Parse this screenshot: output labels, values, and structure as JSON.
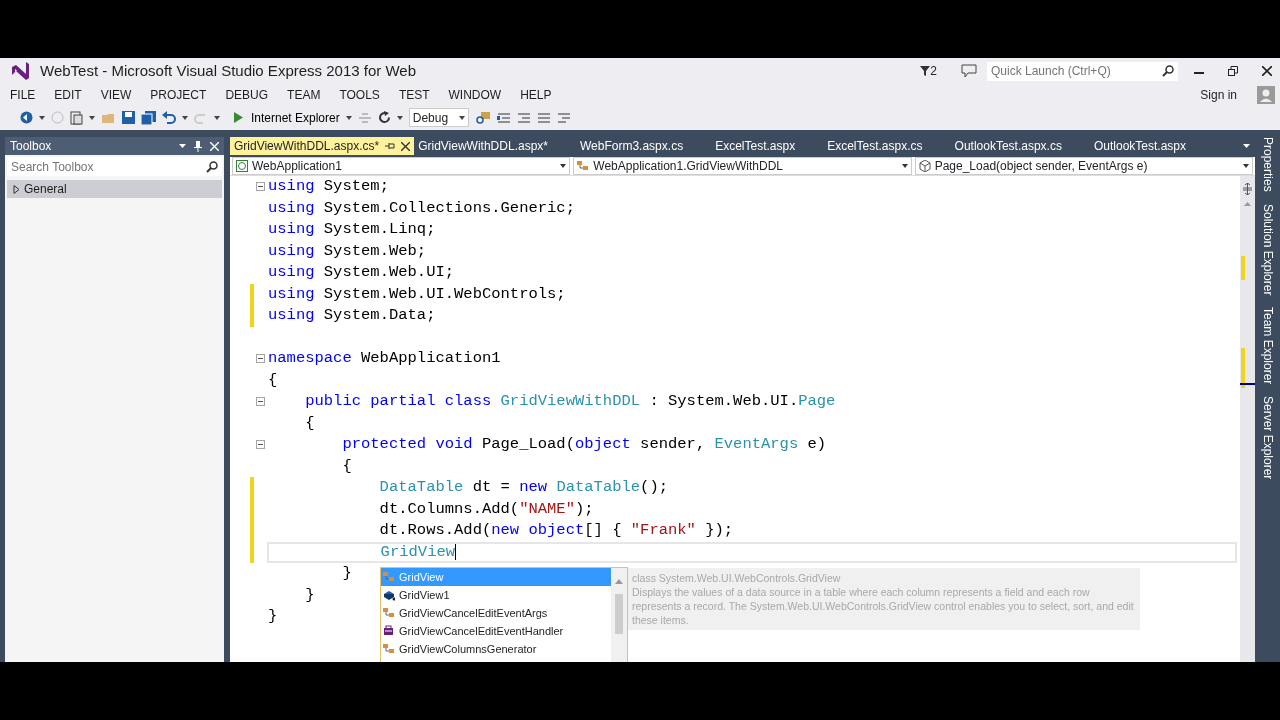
{
  "window": {
    "title": "WebTest - Microsoft Visual Studio Express 2013 for Web",
    "notifications": "2",
    "quick_launch": {
      "placeholder": "Quick Launch (Ctrl+Q)"
    },
    "sign_in": "Sign in"
  },
  "menu": [
    "FILE",
    "EDIT",
    "VIEW",
    "PROJECT",
    "DEBUG",
    "TEAM",
    "TOOLS",
    "TEST",
    "WINDOW",
    "HELP"
  ],
  "toolbar": {
    "run_target": "Internet Explorer",
    "configuration": "Debug"
  },
  "toolbox": {
    "title": "Toolbox",
    "search": {
      "placeholder": "Search Toolbox"
    },
    "groups": [
      {
        "label": "General",
        "expanded": false
      }
    ]
  },
  "tabs": [
    {
      "label": "GridViewWithDDL.aspx.cs*",
      "selected": true
    },
    {
      "label": "GridViewWithDDL.aspx*",
      "selected": false
    },
    {
      "label": "WebForm3.aspx.cs",
      "selected": false
    },
    {
      "label": "ExcelTest.aspx",
      "selected": false
    },
    {
      "label": "ExcelTest.aspx.cs",
      "selected": false
    },
    {
      "label": "OutlookTest.aspx.cs",
      "selected": false
    },
    {
      "label": "OutlookTest.aspx",
      "selected": false
    }
  ],
  "nav_bar": {
    "project": "WebApplication1",
    "type": "WebApplication1.GridViewWithDDL",
    "member": "Page_Load(object sender, EventArgs e)"
  },
  "code": [
    {
      "collapsible": true,
      "changed": false,
      "current": false,
      "tokens": [
        {
          "kind": "keyword",
          "text": "using"
        },
        {
          "kind": "plain",
          "text": " System;"
        }
      ]
    },
    {
      "collapsible": false,
      "changed": false,
      "current": false,
      "tokens": [
        {
          "kind": "keyword",
          "text": "using"
        },
        {
          "kind": "plain",
          "text": " System.Collections.Generic;"
        }
      ]
    },
    {
      "collapsible": false,
      "changed": false,
      "current": false,
      "tokens": [
        {
          "kind": "keyword",
          "text": "using"
        },
        {
          "kind": "plain",
          "text": " System.Linq;"
        }
      ]
    },
    {
      "collapsible": false,
      "changed": false,
      "current": false,
      "tokens": [
        {
          "kind": "keyword",
          "text": "using"
        },
        {
          "kind": "plain",
          "text": " System.Web;"
        }
      ]
    },
    {
      "collapsible": false,
      "changed": false,
      "current": false,
      "tokens": [
        {
          "kind": "keyword",
          "text": "using"
        },
        {
          "kind": "plain",
          "text": " System.Web.UI;"
        }
      ]
    },
    {
      "collapsible": false,
      "changed": true,
      "current": false,
      "tokens": [
        {
          "kind": "keyword",
          "text": "using"
        },
        {
          "kind": "plain",
          "text": " System.Web.UI.WebControls;"
        }
      ]
    },
    {
      "collapsible": false,
      "changed": true,
      "current": false,
      "tokens": [
        {
          "kind": "keyword",
          "text": "using"
        },
        {
          "kind": "plain",
          "text": " System.Data;"
        }
      ]
    },
    {
      "collapsible": false,
      "changed": false,
      "current": false
    },
    {
      "collapsible": true,
      "changed": false,
      "current": false,
      "tokens": [
        {
          "kind": "keyword",
          "text": "namespace"
        },
        {
          "kind": "plain",
          "text": " WebApplication1"
        }
      ]
    },
    {
      "collapsible": false,
      "changed": false,
      "current": false,
      "tokens": [
        {
          "kind": "plain",
          "text": "{"
        }
      ]
    },
    {
      "collapsible": true,
      "changed": false,
      "current": false,
      "tokens": [
        {
          "kind": "keyword",
          "text": "    public partial class "
        },
        {
          "kind": "type",
          "text": "GridViewWithDDL"
        },
        {
          "kind": "plain",
          "text": " : System.Web.UI."
        },
        {
          "kind": "type",
          "text": "Page"
        }
      ]
    },
    {
      "collapsible": false,
      "changed": false,
      "current": false,
      "tokens": [
        {
          "kind": "plain",
          "text": "    {"
        }
      ]
    },
    {
      "collapsible": true,
      "changed": false,
      "current": false,
      "tokens": [
        {
          "kind": "keyword",
          "text": "        protected void"
        },
        {
          "kind": "plain",
          "text": " Page_Load("
        },
        {
          "kind": "keyword",
          "text": "object"
        },
        {
          "kind": "plain",
          "text": " sender, "
        },
        {
          "kind": "type",
          "text": "EventArgs"
        },
        {
          "kind": "plain",
          "text": " e)"
        }
      ]
    },
    {
      "collapsible": false,
      "changed": false,
      "current": false,
      "tokens": [
        {
          "kind": "plain",
          "text": "        {"
        }
      ]
    },
    {
      "collapsible": false,
      "changed": true,
      "current": false,
      "tokens": [
        {
          "kind": "type",
          "text": "            DataTable"
        },
        {
          "kind": "plain",
          "text": " dt = "
        },
        {
          "kind": "keyword",
          "text": "new "
        },
        {
          "kind": "type",
          "text": "DataTable"
        },
        {
          "kind": "plain",
          "text": "();"
        }
      ]
    },
    {
      "collapsible": false,
      "changed": true,
      "current": false,
      "tokens": [
        {
          "kind": "plain",
          "text": "            dt.Columns.Add("
        },
        {
          "kind": "string",
          "text": "\"NAME\""
        },
        {
          "kind": "plain",
          "text": ");"
        }
      ]
    },
    {
      "collapsible": false,
      "changed": true,
      "current": false,
      "tokens": [
        {
          "kind": "plain",
          "text": "            dt.Rows.Add("
        },
        {
          "kind": "keyword",
          "text": "new object"
        },
        {
          "kind": "plain",
          "text": "[] { "
        },
        {
          "kind": "string",
          "text": "\"Frank\""
        },
        {
          "kind": "plain",
          "text": " });"
        }
      ]
    },
    {
      "collapsible": false,
      "changed": true,
      "current": true,
      "tokens": [
        {
          "kind": "type",
          "text": "            GridView"
        }
      ]
    },
    {
      "collapsible": false,
      "changed": false,
      "current": false,
      "tokens": [
        {
          "kind": "plain",
          "text": "        }"
        }
      ]
    },
    {
      "collapsible": false,
      "changed": false,
      "current": false,
      "tokens": [
        {
          "kind": "plain",
          "text": "    }"
        }
      ]
    },
    {
      "collapsible": false,
      "changed": false,
      "current": false,
      "tokens": [
        {
          "kind": "plain",
          "text": "}"
        }
      ]
    }
  ],
  "completion": {
    "items": [
      {
        "label": "GridView",
        "kind": "class",
        "selected": true
      },
      {
        "label": "GridView1",
        "kind": "field",
        "selected": false
      },
      {
        "label": "GridViewCancelEditEventArgs",
        "kind": "class",
        "selected": false
      },
      {
        "label": "GridViewCancelEditEventHandler",
        "kind": "delegate",
        "selected": false
      },
      {
        "label": "GridViewColumnsGenerator",
        "kind": "class",
        "selected": false
      }
    ],
    "tooltip": {
      "signature": "class System.Web.UI.WebControls.GridView",
      "description": "Displays the values of a data source in a table where each column represents a field and each row represents a record. The System.Web.UI.WebControls.GridView control enables you to select, sort, and edit these items."
    }
  },
  "side_tabs": [
    "Properties",
    "Solution Explorer",
    "Team Explorer",
    "Server Explorer"
  ]
}
